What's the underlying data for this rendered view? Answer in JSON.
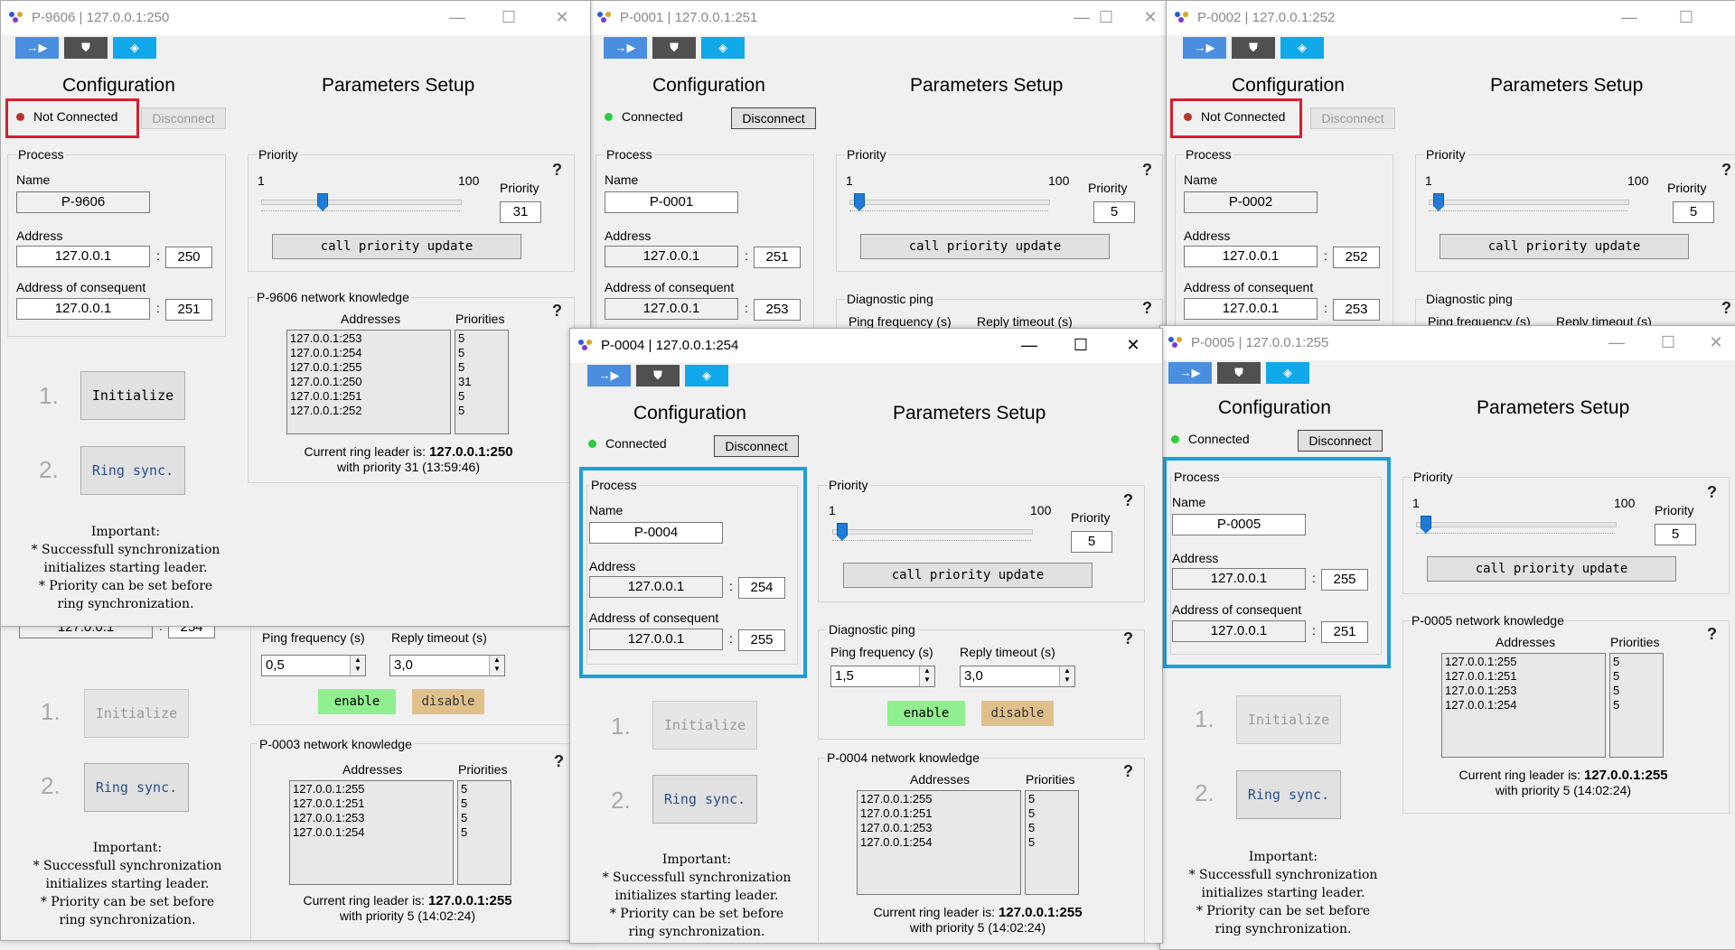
{
  "common": {
    "config_title": "Configuration",
    "params_title": "Parameters Setup",
    "disconnect": "Disconnect",
    "process": "Process",
    "name": "Name",
    "address": "Address",
    "address_consequent": "Address of consequent",
    "priority": "Priority",
    "slider_min": "1",
    "slider_max": "100",
    "call_priority_update": "call priority update",
    "diagnostic_ping": "Diagnostic ping",
    "ping_frequency": "Ping frequency (s)",
    "reply_timeout": "Reply timeout (s)",
    "enable": "enable",
    "disable": "disable",
    "addresses": "Addresses",
    "priorities": "Priorities",
    "initialize": "Initialize",
    "ring_sync": "Ring sync.",
    "step1": "1.",
    "step2": "2.",
    "important_lines": [
      "Important:",
      "* Successfull synchronization",
      "initializes starting leader.",
      "* Priority can be set before",
      "ring synchronization."
    ],
    "current_leader": "Current ring leader is:",
    "colon": ":",
    "help": "?",
    "minimize": "—",
    "maximize": "☐",
    "close": "✕",
    "toolbar": [
      "→▶",
      "⛊",
      "◈"
    ]
  },
  "windows": {
    "w9606": {
      "title": "P-9606 | 127.0.0.1:250",
      "status": "Not Connected",
      "name": "P-9606",
      "address": "127.0.0.1",
      "port": "250",
      "consequent": "127.0.0.1",
      "consequent_port": "251",
      "priority": "31",
      "knowledge_title": "P-9606 network knowledge",
      "addresses": [
        "127.0.0.1:253",
        "127.0.0.1:254",
        "127.0.0.1:255",
        "127.0.0.1:250",
        "127.0.0.1:251",
        "127.0.0.1:252"
      ],
      "priorities": [
        "5",
        "5",
        "5",
        "31",
        "5",
        "5"
      ],
      "leader": "127.0.0.1:250",
      "leader_priority": "with priority 31 (13:59:46)"
    },
    "w0001": {
      "title": "P-0001 | 127.0.0.1:251",
      "status": "Connected",
      "name": "P-0001",
      "address": "127.0.0.1",
      "port": "251",
      "consequent": "127.0.0.1",
      "consequent_port": "253",
      "priority": "5"
    },
    "w0002": {
      "title": "P-0002 | 127.0.0.1:252",
      "status": "Not Connected",
      "name": "P-0002",
      "address": "127.0.0.1",
      "port": "252",
      "consequent": "127.0.0.1",
      "consequent_port": "253",
      "priority": "5"
    },
    "w0003": {
      "consequent": "127.0.0.1",
      "consequent_port": "254",
      "ping_freq": "0,5",
      "reply_timeout": "3,0",
      "knowledge_title": "P-0003 network knowledge",
      "addresses": [
        "127.0.0.1:255",
        "127.0.0.1:251",
        "127.0.0.1:253",
        "127.0.0.1:254"
      ],
      "priorities": [
        "5",
        "5",
        "5",
        "5"
      ],
      "leader": "127.0.0.1:255",
      "leader_priority": "with priority 5 (14:02:24)"
    },
    "w0004": {
      "title": "P-0004 | 127.0.0.1:254",
      "status": "Connected",
      "name": "P-0004",
      "address": "127.0.0.1",
      "port": "254",
      "consequent": "127.0.0.1",
      "consequent_port": "255",
      "priority": "5",
      "ping_freq": "1,5",
      "reply_timeout": "3,0",
      "knowledge_title": "P-0004 network knowledge",
      "addresses": [
        "127.0.0.1:255",
        "127.0.0.1:251",
        "127.0.0.1:253",
        "127.0.0.1:254"
      ],
      "priorities": [
        "5",
        "5",
        "5",
        "5"
      ],
      "leader": "127.0.0.1:255",
      "leader_priority": "with priority 5 (14:02:24)"
    },
    "w0005": {
      "title": "P-0005 | 127.0.0.1:255",
      "status": "Connected",
      "name": "P-0005",
      "address": "127.0.0.1",
      "port": "255",
      "consequent": "127.0.0.1",
      "consequent_port": "251",
      "priority": "5",
      "knowledge_title": "P-0005 network knowledge",
      "addresses": [
        "127.0.0.1:255",
        "127.0.0.1:251",
        "127.0.0.1:253",
        "127.0.0.1:254"
      ],
      "priorities": [
        "5",
        "5",
        "5",
        "5"
      ],
      "leader": "127.0.0.1:255",
      "leader_priority": "with priority 5 (14:02:24)"
    }
  },
  "slider_levels": {
    "w9606": 0.31,
    "w0001": 0.05,
    "w0002": 0.05,
    "w0004": 0.05,
    "w0005": 0.05
  },
  "colors": {
    "not_connected": "#b8332c",
    "connected": "#2ecc40",
    "highlight_red": "#d81d2c",
    "highlight_blue": "#1aa0d8",
    "enable": "#90f090",
    "disable": "#e0c08a"
  }
}
